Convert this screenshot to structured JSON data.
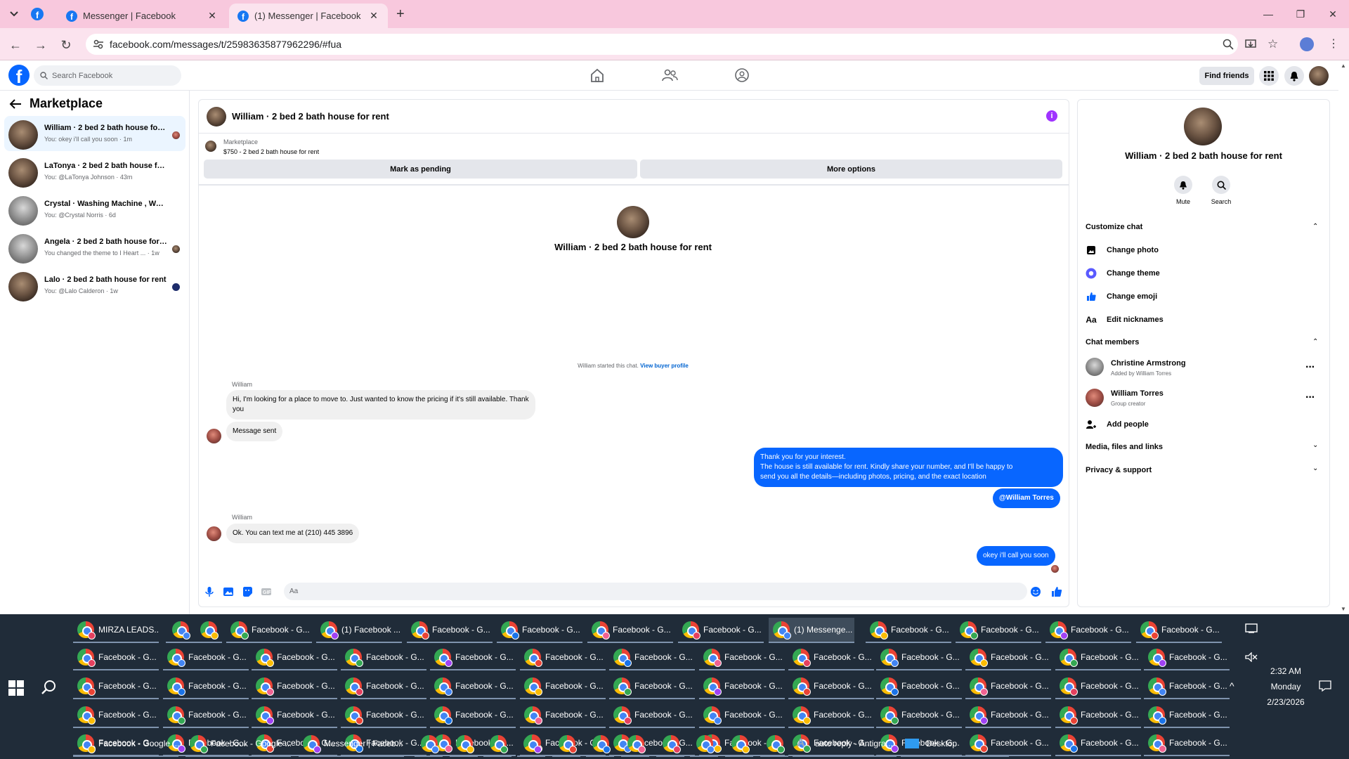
{
  "browser": {
    "tabs": [
      {
        "title": "Messenger | Facebook",
        "active": false
      },
      {
        "title": "(1) Messenger | Facebook",
        "active": true
      }
    ],
    "url": "facebook.com/messages/t/25983635877962296/#fua"
  },
  "fb": {
    "search_placeholder": "Search Facebook",
    "find_friends": "Find friends"
  },
  "left": {
    "title": "Marketplace",
    "conversations": [
      {
        "name": "William · 2 bed 2 bath house for rent",
        "sub": "You: okey i'll call you soon · 1m",
        "active": true
      },
      {
        "name": "LaTonya · 2 bed 2 bath house for rent",
        "sub": "You: @LaTonya Johnson · 43m",
        "active": false
      },
      {
        "name": "Crystal · Washing Machine , Washer",
        "sub": "You: @Crystal Norris · 6d",
        "active": false
      },
      {
        "name": "Angela · 2 bed 2 bath house for rent",
        "sub": "You changed the theme to I Heart ... · 1w",
        "active": false
      },
      {
        "name": "Lalo · 2 bed 2 bath house for rent",
        "sub": "You: @Lalo Calderon · 1w",
        "active": false
      }
    ]
  },
  "chat": {
    "title": "William · 2 bed 2 bath house for rent",
    "marketplace_label": "Marketplace",
    "listing": "$750 - 2 bed 2 bath house for rent",
    "mark_pending": "Mark as pending",
    "more_options": "More options",
    "intro_title": "William · 2 bed 2 bath house for rent",
    "started_text": "William started this chat.",
    "view_buyer": "View buyer profile",
    "messages": [
      {
        "sender": "William",
        "text": "Hi, I'm looking for a place to move to. Just wanted to know the pricing if it's still available. Thank you"
      },
      {
        "text": "Message sent"
      },
      {
        "text_lines": [
          "Thank you for your interest.",
          "The house is still available for rent. Kindly share your number, and I'll be happy to",
          "send you all the details—including photos, pricing, and the exact location"
        ]
      },
      {
        "text": "@William Torres"
      },
      {
        "sender": "William",
        "text": "Ok. You can text me at (210) 445 3896"
      },
      {
        "text": "okey i'll call you soon"
      }
    ],
    "composer_placeholder": "Aa"
  },
  "right": {
    "title": "William · 2 bed 2 bath house for rent",
    "mute": "Mute",
    "search": "Search",
    "customize_chat": "Customize chat",
    "change_photo": "Change photo",
    "change_theme": "Change theme",
    "change_emoji": "Change emoji",
    "edit_nicknames": "Edit nicknames",
    "chat_members": "Chat members",
    "members": [
      {
        "name": "Christine Armstrong",
        "sub": "Added by William Torres"
      },
      {
        "name": "William Torres",
        "sub": "Group creator"
      }
    ],
    "add_people": "Add people",
    "media_files": "Media, files and links",
    "privacy_support": "Privacy & support"
  },
  "taskbar": {
    "row1": [
      "MIRZA LEADS...",
      "",
      "",
      "Facebook - G...",
      "(1) Facebook ...",
      "Facebook - G...",
      "Facebook - G...",
      "Facebook - G...",
      "Facebook - G...",
      "(1) Messenge...",
      "Facebook - G...",
      "Facebook - G...",
      "Facebook - G...",
      "Facebook - G..."
    ],
    "grid_label": "Facebook - G...",
    "row5": [
      "Facebook - Google ...",
      "Facebook - Google ...",
      "Messenger | Faceb...",
      "auto reply - Antigra...",
      "Desktop"
    ],
    "time": "2:32 AM",
    "day": "Monday",
    "date": "2/23/2026"
  },
  "colors": {
    "accent": "#0866ff",
    "tabbar": "#f8c8dd",
    "taskbar": "#202c39"
  }
}
